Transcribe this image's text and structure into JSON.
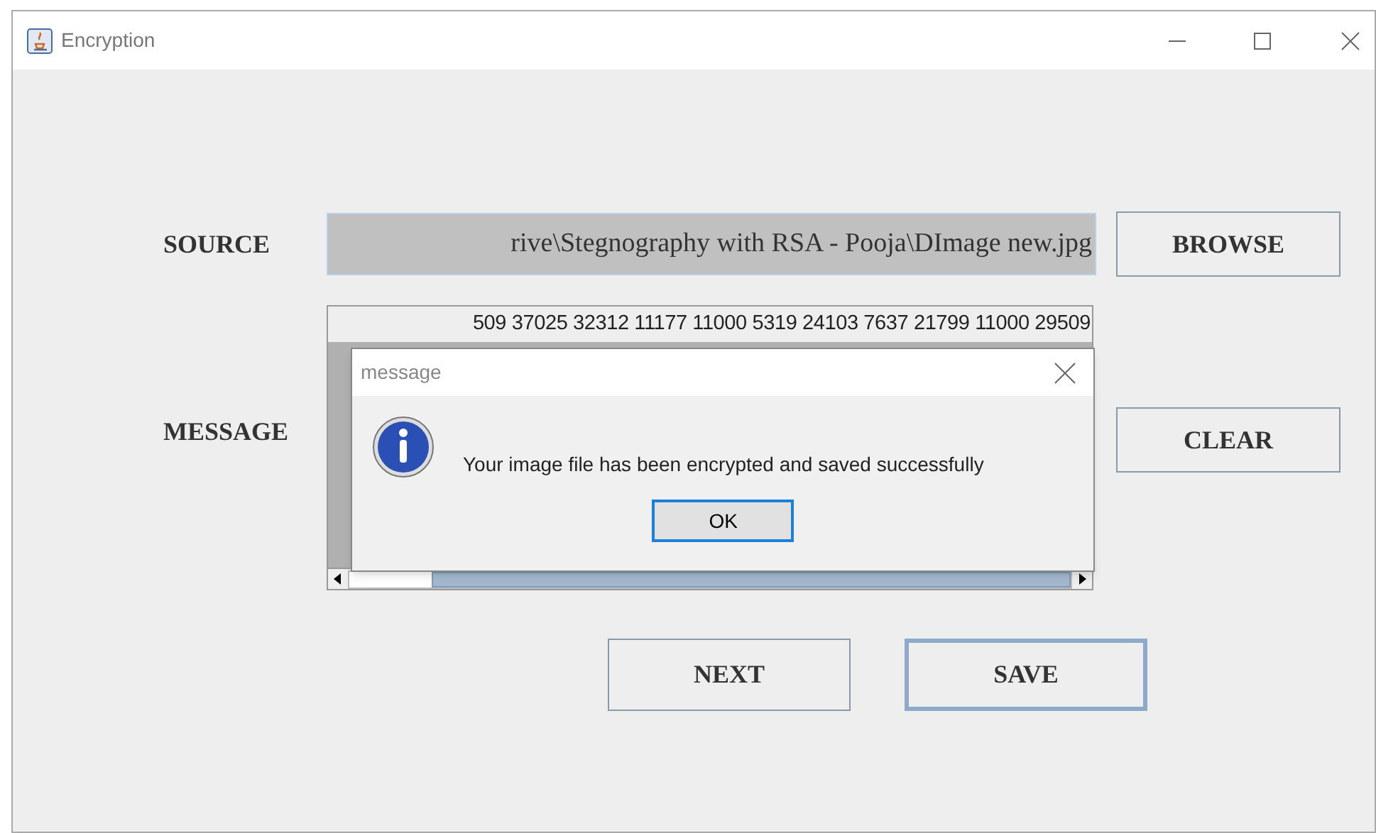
{
  "window": {
    "title": "Encryption"
  },
  "source": {
    "label": "SOURCE",
    "value": "rive\\Stegnography with RSA - Pooja\\DImage new.jpg",
    "button": "BROWSE"
  },
  "message": {
    "label": "MESSAGE",
    "value": "509 37025 32312 11177 11000 5319 24103 7637 21799 11000 29509",
    "button": "CLEAR"
  },
  "buttons": [
    {
      "label": "NEXT",
      "focused": false
    },
    {
      "label": "SAVE",
      "focused": true
    }
  ],
  "dialog": {
    "title": "message",
    "text": "Your image file has been encrypted and saved successfully",
    "button": "OK"
  }
}
